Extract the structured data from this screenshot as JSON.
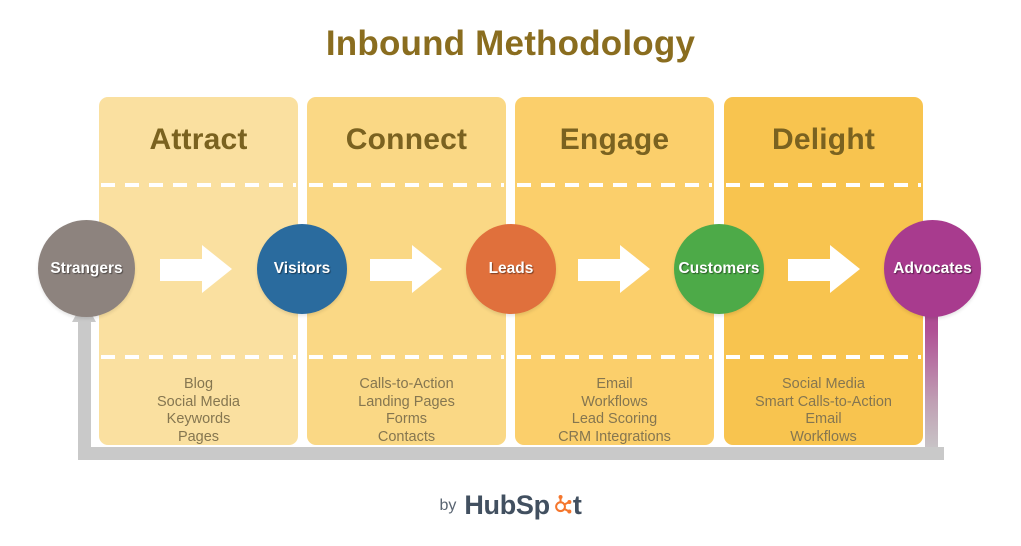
{
  "title": "Inbound Methodology",
  "stages": [
    {
      "name": "Attract",
      "color": "#fae0a0",
      "tactics": [
        "Blog",
        "Social Media",
        "Keywords",
        "Pages"
      ]
    },
    {
      "name": "Connect",
      "color": "#fad885",
      "tactics": [
        "Calls-to-Action",
        "Landing Pages",
        "Forms",
        "Contacts"
      ]
    },
    {
      "name": "Engage",
      "color": "#fbcf6b",
      "tactics": [
        "Email",
        "Workflows",
        "Lead Scoring",
        "CRM Integrations"
      ]
    },
    {
      "name": "Delight",
      "color": "#f8c44f",
      "tactics": [
        "Social Media",
        "Smart Calls-to-Action",
        "Email",
        "Workflows"
      ]
    }
  ],
  "personas": [
    {
      "label": "Strangers",
      "color": "#8d837e"
    },
    {
      "label": "Visitors",
      "color": "#2a6b9e"
    },
    {
      "label": "Leads",
      "color": "#e0703c"
    },
    {
      "label": "Customers",
      "color": "#4daa48"
    },
    {
      "label": "Advocates",
      "color": "#a83b8e"
    }
  ],
  "footer": {
    "by": "by",
    "brand_pre": "HubSp",
    "brand_post": "t",
    "sprocket_color": "#f5762c",
    "brand_color": "#425060"
  },
  "colors": {
    "title": "#8a6d1f",
    "heading": "#7a6220",
    "tactic_text": "#857650",
    "arrow": "#ffffff",
    "loop": "#c9c9c9"
  }
}
